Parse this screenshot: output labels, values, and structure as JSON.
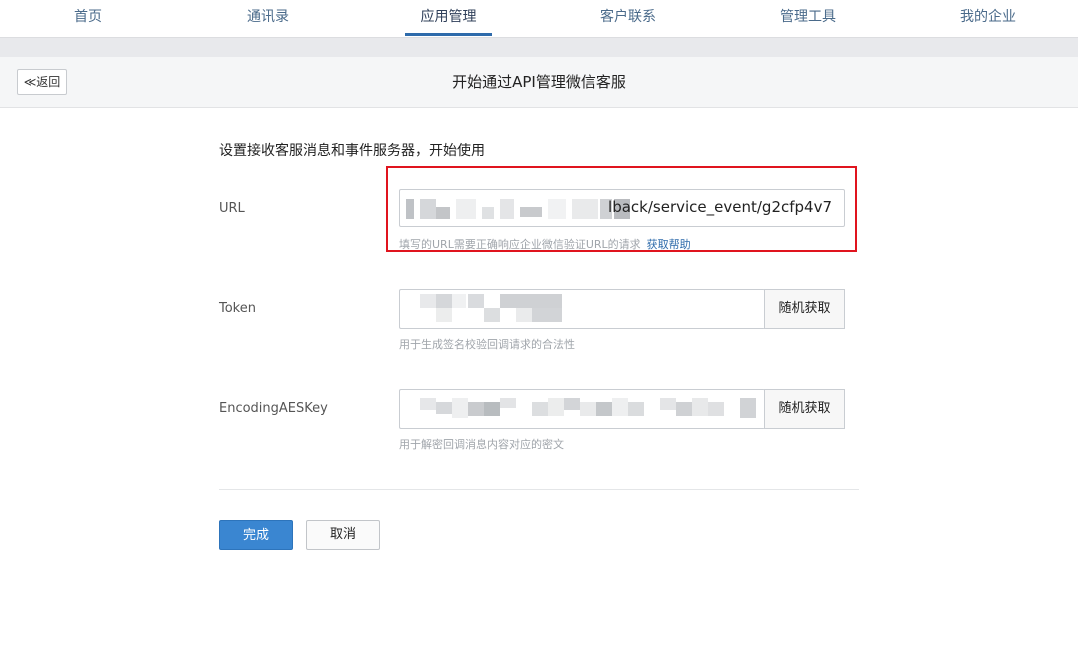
{
  "nav": {
    "items": [
      {
        "label": "首页",
        "active": false
      },
      {
        "label": "通讯录",
        "active": false
      },
      {
        "label": "应用管理",
        "active": true
      },
      {
        "label": "客户联系",
        "active": false
      },
      {
        "label": "管理工具",
        "active": false
      },
      {
        "label": "我的企业",
        "active": false
      }
    ]
  },
  "header": {
    "back_label": "≪返回",
    "title": "开始通过API管理微信客服"
  },
  "form": {
    "intro": "设置接收客服消息和事件服务器，开始使用",
    "url": {
      "label": "URL",
      "value_visible": "lback/service_event/g2cfp4v7",
      "hint": "填写的URL需要正确响应企业微信验证URL的请求",
      "help_link": "获取帮助"
    },
    "token": {
      "label": "Token",
      "hint": "用于生成签名校验回调请求的合法性",
      "random_button": "随机获取"
    },
    "aeskey": {
      "label": "EncodingAESKey",
      "hint": "用于解密回调消息内容对应的密文",
      "random_button": "随机获取"
    }
  },
  "actions": {
    "confirm_label": "完成",
    "cancel_label": "取消"
  },
  "colors": {
    "accent": "#2e6bab",
    "primary_button": "#3a86d1",
    "highlight_border": "#e0141e",
    "header_bg": "#f5f6f7"
  }
}
